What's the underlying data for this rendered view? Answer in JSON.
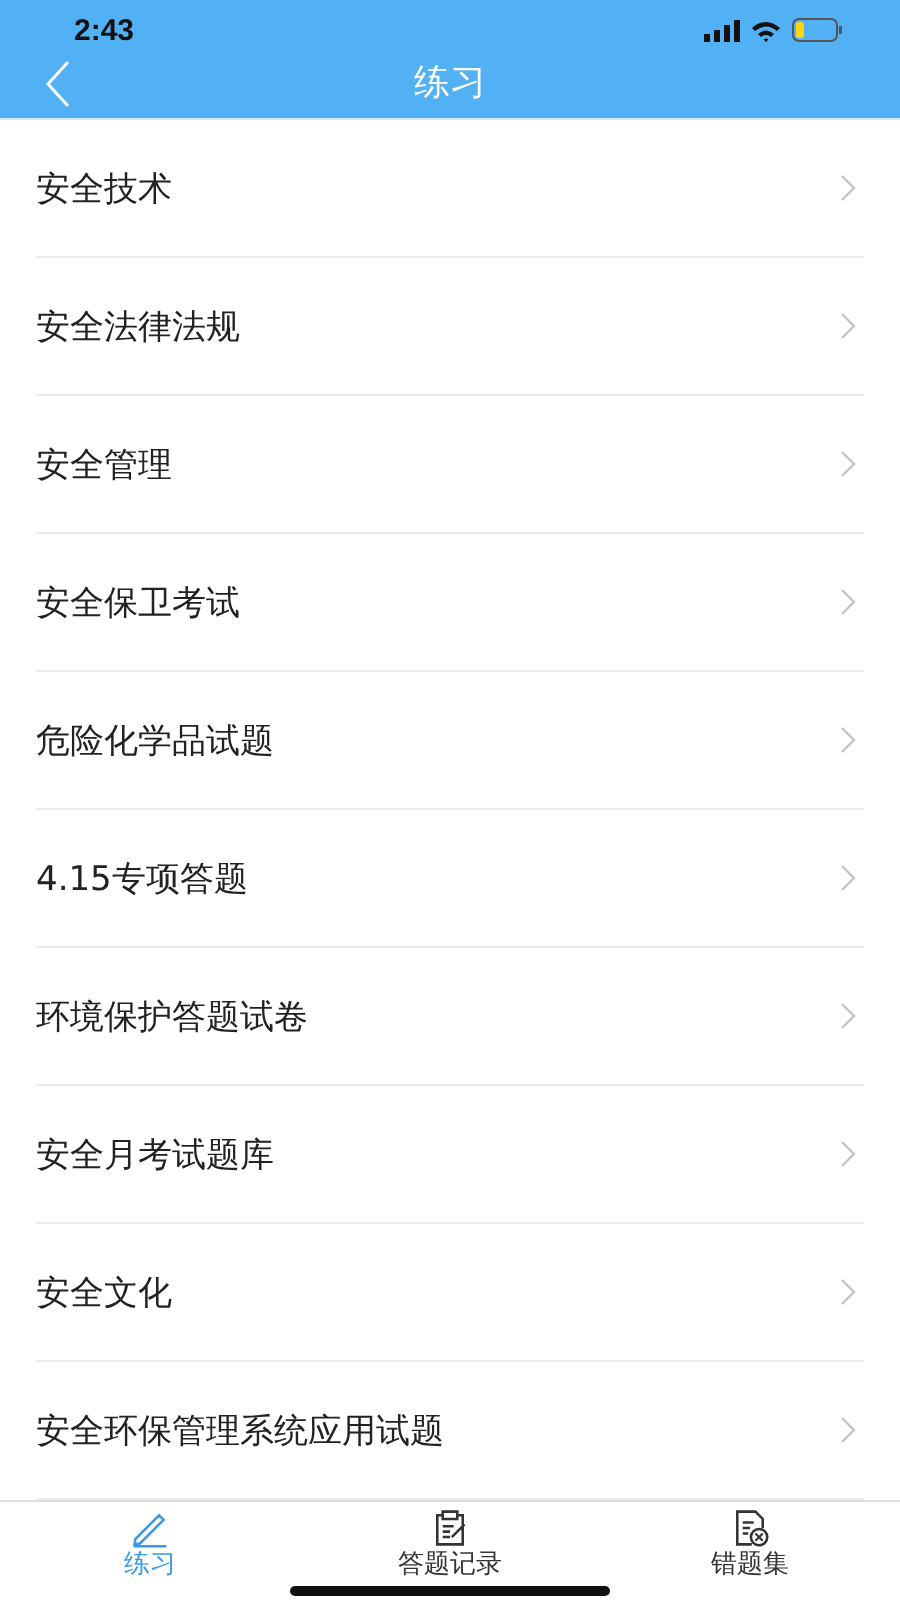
{
  "status_bar": {
    "time": "2:43"
  },
  "header": {
    "title": "练习"
  },
  "items": [
    {
      "label": "安全技术"
    },
    {
      "label": "安全法律法规"
    },
    {
      "label": "安全管理"
    },
    {
      "label": "安全保卫考试"
    },
    {
      "label": "危险化学品试题"
    },
    {
      "label": "4.15专项答题"
    },
    {
      "label": "环境保护答题试卷"
    },
    {
      "label": "安全月考试题库"
    },
    {
      "label": "安全文化"
    },
    {
      "label": "安全环保管理系统应用试题"
    }
  ],
  "tabs": [
    {
      "label": "练习",
      "kind": "pencil",
      "selected": true
    },
    {
      "label": "答题记录",
      "kind": "record",
      "selected": false
    },
    {
      "label": "错题集",
      "kind": "mistakes",
      "selected": false
    }
  ]
}
